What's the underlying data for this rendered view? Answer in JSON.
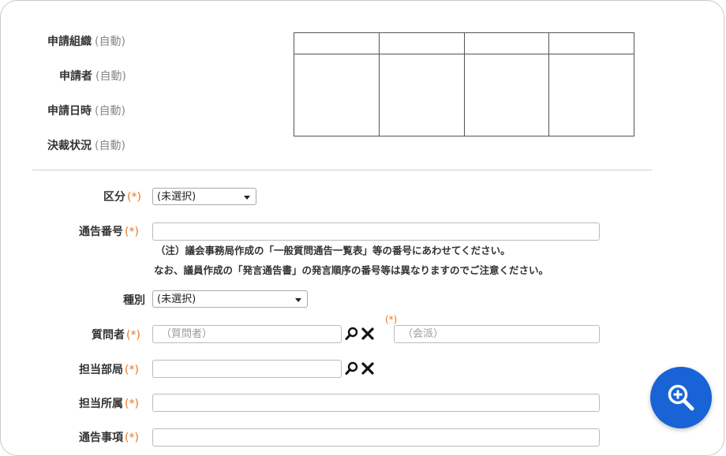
{
  "auto_label": "(自動)",
  "required_mark": "(*)",
  "info": {
    "org_label": "申請組織",
    "applicant_label": "申請者",
    "date_label": "申請日時",
    "approval_label": "決裁状況"
  },
  "form": {
    "category_label": "区分",
    "category_value": "(未選択)",
    "notice_no_label": "通告番号",
    "notice_no_value": "",
    "note_line1": "（注）議会事務局作成の「一般質問通告一覧表」等の番号にあわせてください。",
    "note_line2": "なお、議員作成の「発言通告書」の発言順序の番号等は異なりますのでご注意ください。",
    "type_label": "種別",
    "type_value": "(未選択)",
    "questioner_label": "質問者",
    "questioner_placeholder": "（質問者）",
    "faction_required_mark": "(*)",
    "faction_placeholder": "（会派）",
    "dept_label": "担当部局",
    "dept_value": "",
    "section_label": "担当所属",
    "section_value": "",
    "item_label": "通告事項",
    "item_value": ""
  }
}
